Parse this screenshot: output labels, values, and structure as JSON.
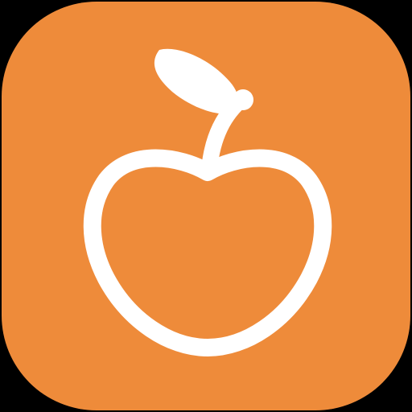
{
  "app_icon": {
    "icon": "apple-icon",
    "colors": {
      "background": "#000000",
      "tile": "#EE8B3A",
      "glyph": "#FFFFFF"
    }
  }
}
